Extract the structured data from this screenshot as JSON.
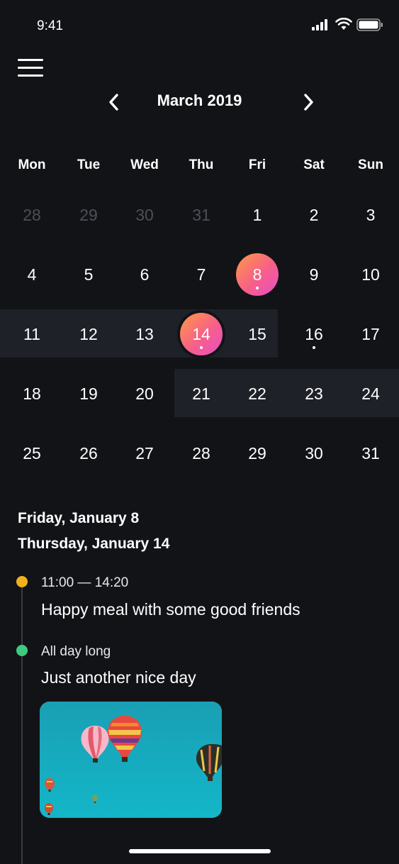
{
  "status_bar": {
    "time": "9:41"
  },
  "header": {
    "month_title": "March 2019"
  },
  "weekdays": [
    "Mon",
    "Tue",
    "Wed",
    "Thu",
    "Fri",
    "Sat",
    "Sun"
  ],
  "calendar": {
    "weeks": [
      [
        {
          "day": "28",
          "muted": true
        },
        {
          "day": "29",
          "muted": true
        },
        {
          "day": "30",
          "muted": true
        },
        {
          "day": "31",
          "muted": true
        },
        {
          "day": "1"
        },
        {
          "day": "2"
        },
        {
          "day": "3"
        }
      ],
      [
        {
          "day": "4"
        },
        {
          "day": "5"
        },
        {
          "day": "6"
        },
        {
          "day": "7"
        },
        {
          "day": "8",
          "selected": true,
          "has_event": true
        },
        {
          "day": "9"
        },
        {
          "day": "10"
        }
      ],
      [
        {
          "day": "11"
        },
        {
          "day": "12"
        },
        {
          "day": "13"
        },
        {
          "day": "14",
          "selected": true,
          "has_event": true
        },
        {
          "day": "15"
        },
        {
          "day": "16",
          "has_event": true
        },
        {
          "day": "17"
        }
      ],
      [
        {
          "day": "18"
        },
        {
          "day": "19"
        },
        {
          "day": "20"
        },
        {
          "day": "21"
        },
        {
          "day": "22"
        },
        {
          "day": "23"
        },
        {
          "day": "24"
        }
      ],
      [
        {
          "day": "25"
        },
        {
          "day": "26"
        },
        {
          "day": "27"
        },
        {
          "day": "28"
        },
        {
          "day": "29"
        },
        {
          "day": "30"
        },
        {
          "day": "31"
        }
      ]
    ],
    "highlighted_ranges": [
      {
        "week": 1,
        "from_col": 0,
        "to_col": 4
      },
      {
        "week": 2,
        "from_col": 3,
        "to_col": 6
      }
    ]
  },
  "agenda": {
    "dates": [
      "Friday, January 8",
      "Thursday, January 14"
    ],
    "events": [
      {
        "time": "11:00 — 14:20",
        "title": "Happy meal with some good friends",
        "dot_color": "#f2b01e"
      },
      {
        "time": "All day long",
        "title": "Just another nice day",
        "dot_color": "#3ecb7f"
      }
    ]
  },
  "colors": {
    "background": "#121317",
    "highlight_band": "#1f2128",
    "selected_gradient": [
      "#ff9a44",
      "#f75f89",
      "#e84ec9"
    ],
    "muted_text": "#4d4f57"
  },
  "icons": {
    "menu": "menu-icon",
    "prev": "chevron-left-icon",
    "next": "chevron-right-icon",
    "signal": "cellular-signal-icon",
    "wifi": "wifi-icon",
    "battery": "battery-icon"
  }
}
